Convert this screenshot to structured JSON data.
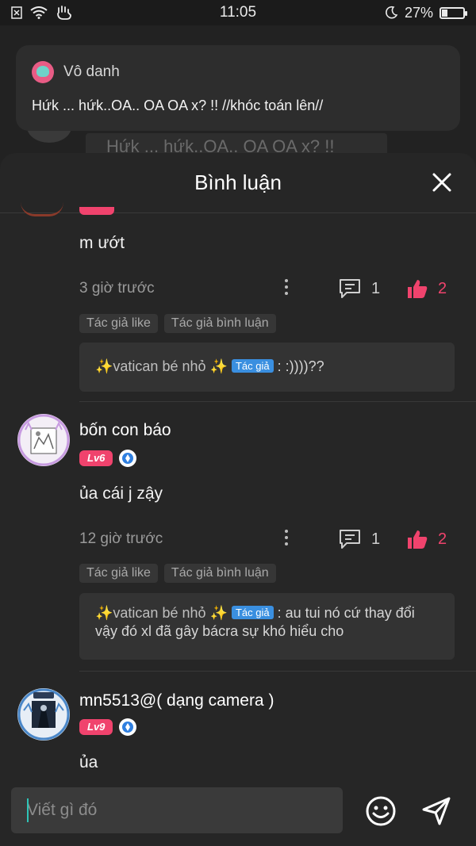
{
  "status_bar": {
    "time": "11:05",
    "battery_percent": "27%",
    "battery_level": 0.27
  },
  "background": {
    "comment_text": "Hứk ... hứk..OA.. OA OA x? !!"
  },
  "popup": {
    "author": "Vô danh",
    "text": "Hứk ... hứk..OA.. OA OA x? !! //khóc toán lên//"
  },
  "sheet": {
    "title": "Bình luận"
  },
  "comments": [
    {
      "text": "m ướt",
      "time": "3 giờ trước",
      "reply_count": "1",
      "like_count": "2",
      "tags": [
        "Tác giả like",
        "Tác giả bình luận"
      ],
      "reply": {
        "author": "✨vatican bé nhỏ ✨",
        "author_badge": "Tác giả",
        "text": ": :))))??"
      }
    },
    {
      "name": "bốn con báo",
      "level": "Lv6",
      "text": "ủa cái j zậy",
      "time": "12 giờ trước",
      "reply_count": "1",
      "like_count": "2",
      "tags": [
        "Tác giả like",
        "Tác giả bình luận"
      ],
      "reply": {
        "author": "✨vatican bé nhỏ ✨",
        "author_badge": "Tác giả",
        "text": ": au tui nó cứ thay đổi vậy đó xl đã gây bácra sự khó hiểu cho"
      }
    },
    {
      "name": "mn5513@( dạng camera )",
      "level": "Lv9",
      "text": "ủa"
    }
  ],
  "input": {
    "placeholder": "Viết gì đó"
  },
  "colors": {
    "accent": "#f0436d",
    "author_badge": "#3a8fe0",
    "sheet_bg": "#262626"
  },
  "icons": [
    "close-icon",
    "more-icon",
    "comment-icon",
    "thumbs-up-icon",
    "emoji-icon",
    "send-icon",
    "gem-icon"
  ]
}
